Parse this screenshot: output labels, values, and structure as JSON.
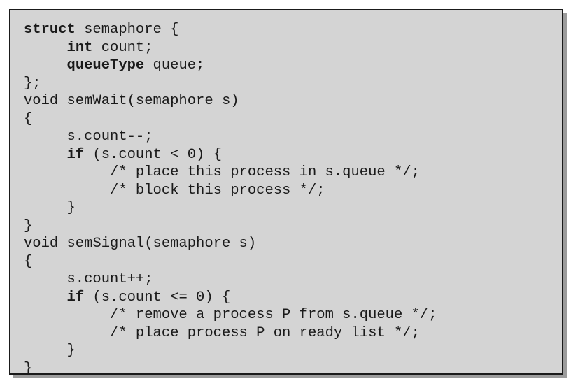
{
  "code": {
    "lines": [
      [
        {
          "t": "struct",
          "kw": true
        },
        {
          "t": " semaphore {"
        }
      ],
      [
        {
          "t": "     "
        },
        {
          "t": "int",
          "kw": true
        },
        {
          "t": " count;"
        }
      ],
      [
        {
          "t": "     "
        },
        {
          "t": "queueType",
          "kw": true
        },
        {
          "t": " queue;"
        }
      ],
      [
        {
          "t": "};"
        }
      ],
      [
        {
          "t": "void semWait(semaphore s)"
        }
      ],
      [
        {
          "t": "{"
        }
      ],
      [
        {
          "t": "     s.count"
        },
        {
          "t": "--",
          "kw": true
        },
        {
          "t": ";"
        }
      ],
      [
        {
          "t": "     "
        },
        {
          "t": "if",
          "kw": true
        },
        {
          "t": " (s.count < 0) {"
        }
      ],
      [
        {
          "t": "          /* place this process in s.queue */;"
        }
      ],
      [
        {
          "t": "          /* block this process */;"
        }
      ],
      [
        {
          "t": "     }"
        }
      ],
      [
        {
          "t": "}"
        }
      ],
      [
        {
          "t": "void semSignal(semaphore s)"
        }
      ],
      [
        {
          "t": "{"
        }
      ],
      [
        {
          "t": "     s.count++;"
        }
      ],
      [
        {
          "t": "     "
        },
        {
          "t": "if",
          "kw": true
        },
        {
          "t": " (s.count <= 0) {"
        }
      ],
      [
        {
          "t": "          /* remove a process P from s.queue */;"
        }
      ],
      [
        {
          "t": "          /* place process P on ready list */;"
        }
      ],
      [
        {
          "t": "     }"
        }
      ],
      [
        {
          "t": "}"
        }
      ]
    ]
  }
}
